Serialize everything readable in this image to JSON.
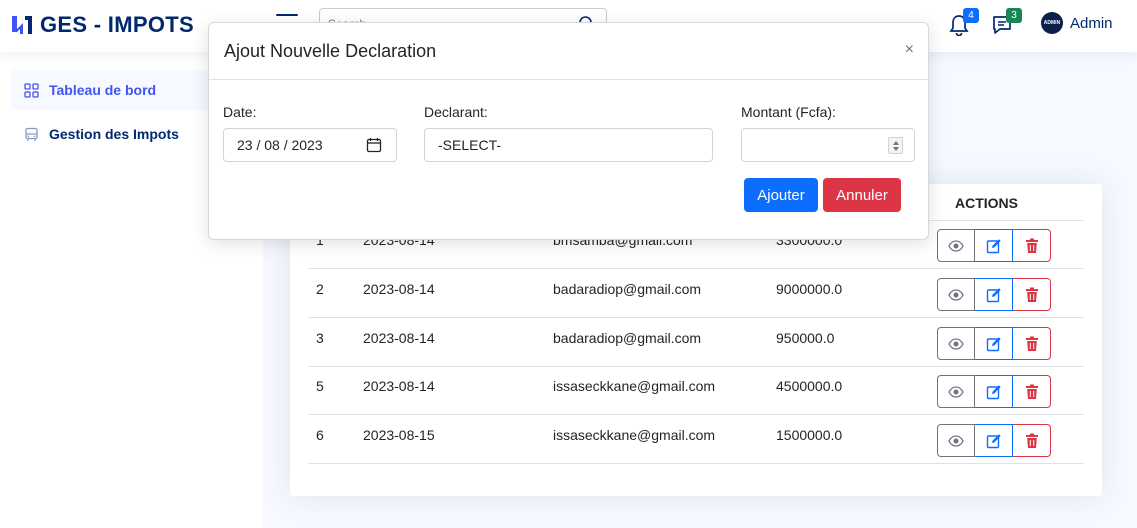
{
  "header": {
    "brand": "GES - IMPOTS",
    "search_placeholder": "Search",
    "notifications_count": "4",
    "messages_count": "3",
    "avatar_text": "ADMIN",
    "profile_name": "Admin"
  },
  "sidebar": {
    "items": [
      {
        "label": "Tableau de bord",
        "icon": "grid-icon",
        "active": true
      },
      {
        "label": "Gestion des Impots",
        "icon": "bus-icon",
        "active": false
      }
    ]
  },
  "table": {
    "actions_header": "ACTIONS",
    "rows": [
      {
        "id": "1",
        "date": "2023-08-14",
        "email": "bmsamba@gmail.com",
        "amount": "3300000.0"
      },
      {
        "id": "2",
        "date": "2023-08-14",
        "email": "badaradiop@gmail.com",
        "amount": "9000000.0"
      },
      {
        "id": "3",
        "date": "2023-08-14",
        "email": "badaradiop@gmail.com",
        "amount": "950000.0"
      },
      {
        "id": "5",
        "date": "2023-08-14",
        "email": "issaseckkane@gmail.com",
        "amount": "4500000.0"
      },
      {
        "id": "6",
        "date": "2023-08-15",
        "email": "issaseckkane@gmail.com",
        "amount": "1500000.0"
      }
    ]
  },
  "modal": {
    "title": "Ajout Nouvelle Declaration",
    "close_symbol": "×",
    "date_label": "Date:",
    "date_value": "23 / 08 / 2023",
    "declarant_label": "Declarant:",
    "declarant_value": "-SELECT-",
    "montant_label": "Montant (Fcfa):",
    "montant_value": "",
    "submit_label": "Ajouter",
    "cancel_label": "Annuler"
  },
  "colors": {
    "brand": "#012970",
    "accent": "#4154f1",
    "primary": "#0d6efd",
    "danger": "#dc3545",
    "success": "#198754"
  }
}
